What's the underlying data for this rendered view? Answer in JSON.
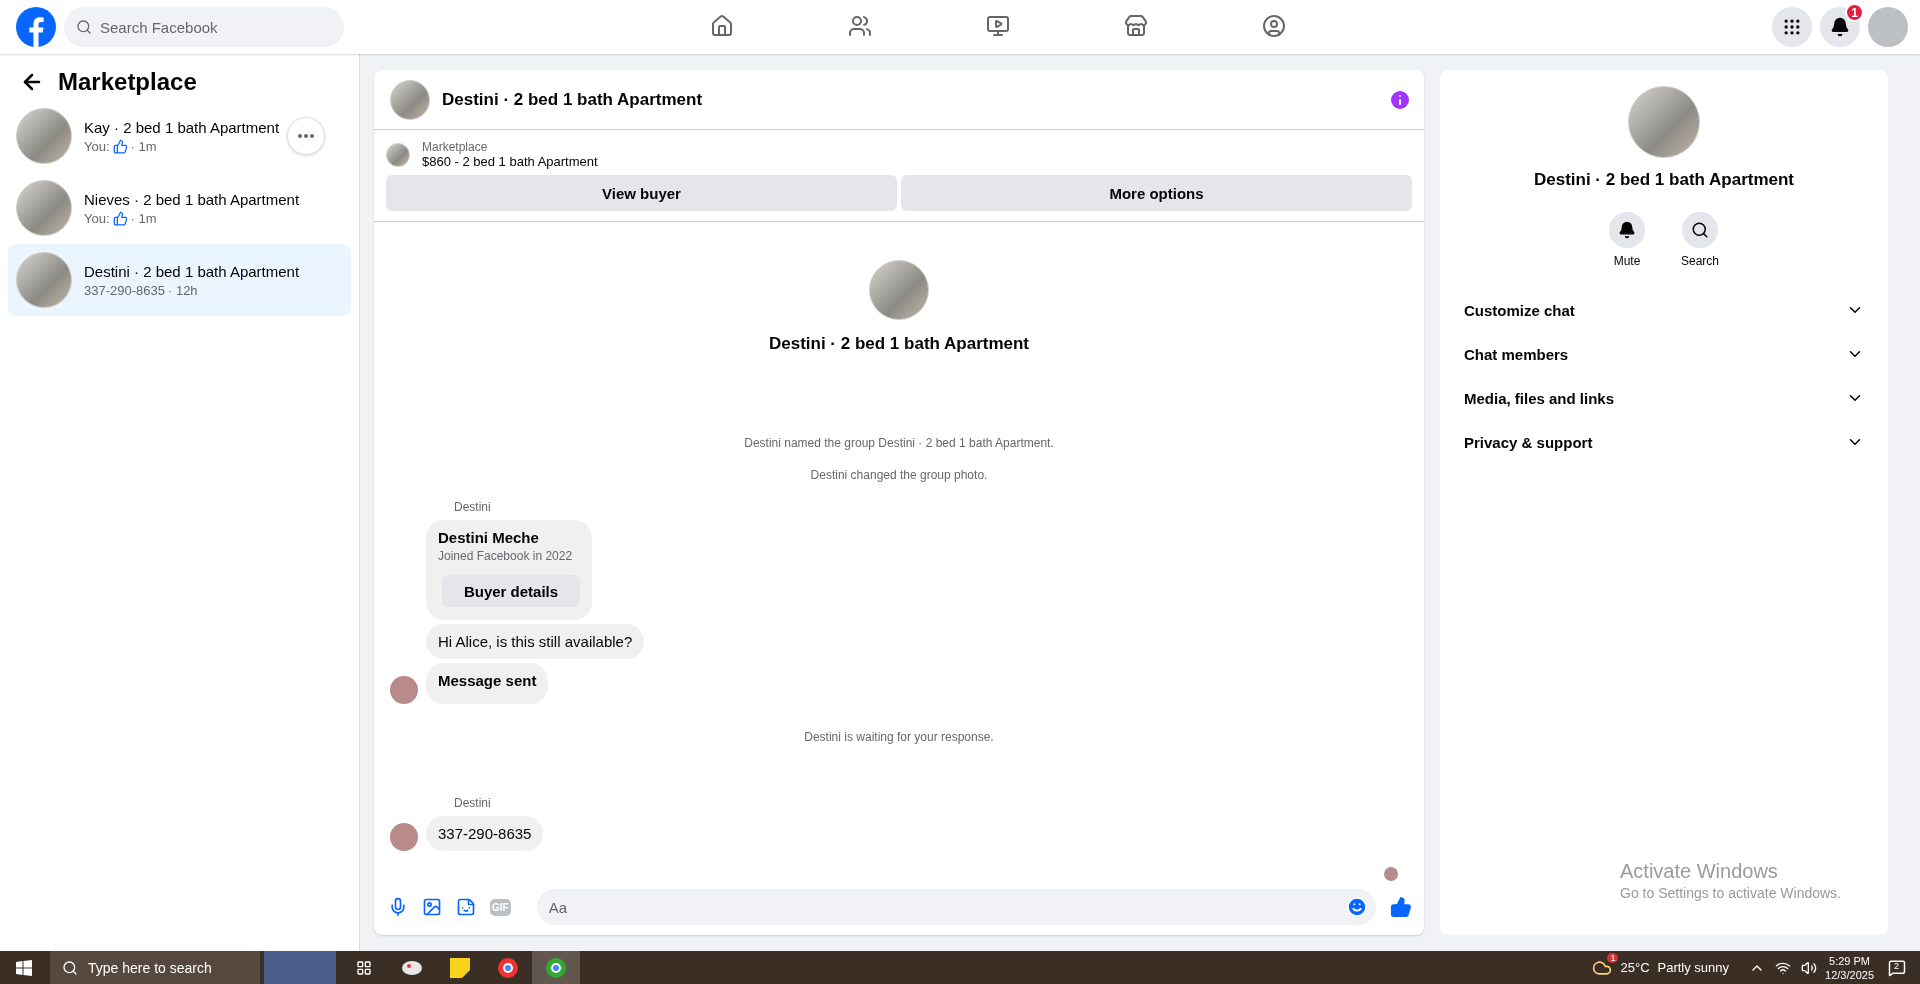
{
  "topbar": {
    "search": {
      "placeholder": "Search Facebook"
    },
    "nav": [
      {
        "kind": "home",
        "selected": false
      },
      {
        "kind": "friends",
        "selected": false
      },
      {
        "kind": "video",
        "selected": false
      },
      {
        "kind": "marketplace",
        "selected": false
      },
      {
        "kind": "groups",
        "selected": false
      }
    ],
    "notification_count": "1"
  },
  "sidebar": {
    "title": "Marketplace",
    "conversations": [
      {
        "title": "Kay · 2 bed 1 bath Apartment",
        "preview": "You:",
        "liked": true,
        "time": "· 1m",
        "selected": false,
        "menu": true
      },
      {
        "title": "Nieves · 2 bed 1 bath Apartment",
        "preview": "You:",
        "liked": true,
        "time": "· 1m",
        "selected": false,
        "menu": false
      },
      {
        "title": "Destini · 2 bed 1 bath Apartment",
        "preview": "337-290-8635",
        "liked": false,
        "time": "· 12h",
        "selected": true,
        "menu": false
      }
    ]
  },
  "chat": {
    "title": "Destini · 2 bed 1 bath Apartment",
    "listing": {
      "label": "Marketplace",
      "name": "$860 - 2 bed 1 bath Apartment"
    },
    "buttons": [
      "View buyer",
      "More options"
    ],
    "intro_title": "Destini · 2 bed 1 bath Apartment",
    "messages": [
      {
        "kind": "system",
        "text": "Destini named the group Destini · 2 bed 1 bath Apartment."
      },
      {
        "kind": "system",
        "text": "Destini changed the group photo."
      },
      {
        "kind": "sender",
        "text": "Destini"
      },
      {
        "kind": "card",
        "name": "Destini Meche",
        "detail": "Joined Facebook in 2022",
        "button": "Buyer details"
      },
      {
        "kind": "bubble",
        "text": "Hi Alice, is this still available?",
        "avatar": false,
        "bold": false
      },
      {
        "kind": "bubble",
        "text": "Message sent",
        "avatar": true,
        "bold": true
      },
      {
        "kind": "status",
        "text": "Destini is waiting for your response."
      },
      {
        "kind": "sender",
        "text": "Destini"
      },
      {
        "kind": "bubble",
        "text": "337-290-8635",
        "avatar": true,
        "bold": false
      },
      {
        "kind": "seen"
      }
    ],
    "composer": {
      "placeholder": "Aa",
      "gif_label": "GIF"
    }
  },
  "details": {
    "title": "Destini · 2 bed 1 bath Apartment",
    "actions": [
      {
        "kind": "mute",
        "label": "Mute"
      },
      {
        "kind": "search",
        "label": "Search"
      }
    ],
    "sections": [
      {
        "label": "Customize chat",
        "expanded": false
      },
      {
        "label": "Chat members",
        "expanded": false
      },
      {
        "label": "Media, files and links",
        "expanded": false
      },
      {
        "label": "Privacy & support",
        "expanded": false
      }
    ]
  },
  "activation": {
    "title": "Activate Windows",
    "text": "Go to Settings to activate Windows."
  },
  "taskbar": {
    "search_placeholder": "Type here to search",
    "weather_badge": "1",
    "temperature": "25°C",
    "weather": "Partly sunny",
    "time": "5:29 PM",
    "date": "12/3/2025",
    "notification_count": "2"
  }
}
